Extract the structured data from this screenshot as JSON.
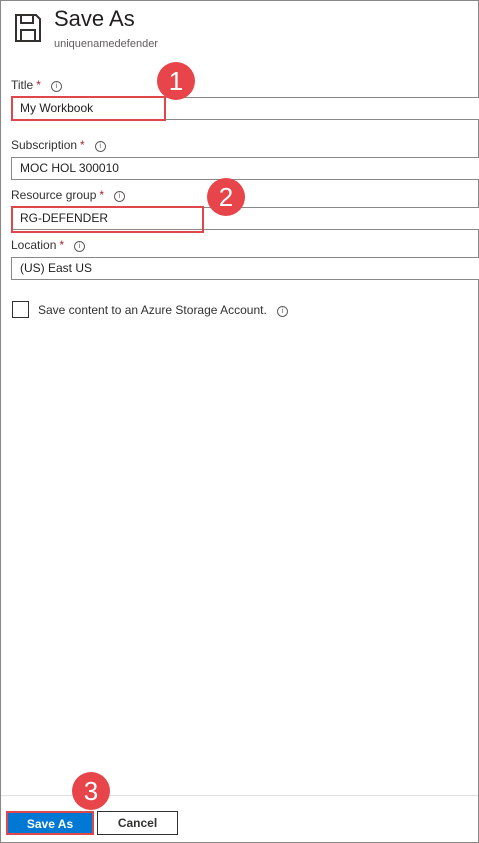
{
  "header": {
    "title": "Save As",
    "subtitle": "uniquenamedefender",
    "icon": "save-icon"
  },
  "form": {
    "required_marker": "*",
    "title": {
      "label": "Title",
      "value": "My Workbook"
    },
    "subscription": {
      "label": "Subscription",
      "value": "MOC HOL 300010"
    },
    "resource_group": {
      "label": "Resource group",
      "value": "RG-DEFENDER"
    },
    "location": {
      "label": "Location",
      "value": "(US) East US"
    },
    "storage": {
      "label": "Save content to an Azure Storage Account.",
      "checked": false
    }
  },
  "callouts": [
    "1",
    "2",
    "3"
  ],
  "footer": {
    "save_label": "Save As",
    "cancel_label": "Cancel"
  },
  "colors": {
    "accent": "#0078d4",
    "callout": "#e7454a",
    "required": "#a4262c"
  }
}
